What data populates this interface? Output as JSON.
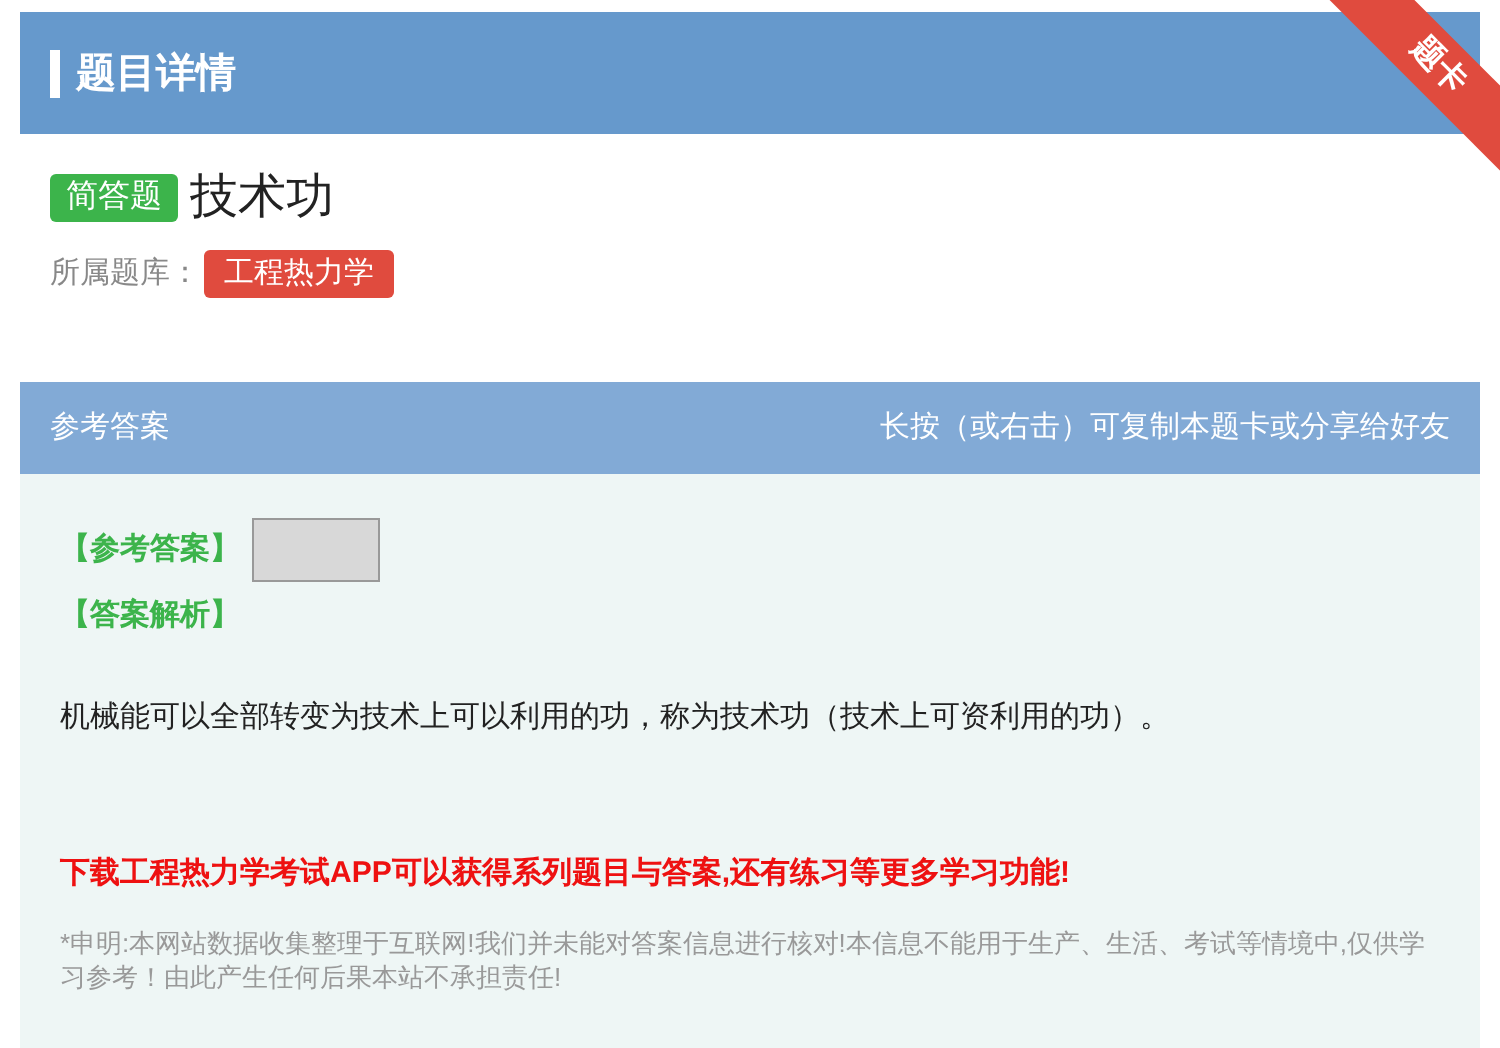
{
  "header": {
    "title": "题目详情",
    "ribbon": "题卡"
  },
  "question": {
    "type_badge": "简答题",
    "title": "技术功",
    "bank_label": "所属题库：",
    "bank": "工程热力学"
  },
  "answer_panel": {
    "title": "参考答案",
    "hint": "长按（或右击）可复制本题卡或分享给好友",
    "answer_label": "【参考答案】",
    "analysis_label": "【答案解析】",
    "analysis": "机械能可以全部转变为技术上可以利用的功，称为技术功（技术上可资利用的功）。",
    "promo": "下载工程热力学考试APP可以获得系列题目与答案,还有练习等更多学习功能!",
    "disclaimer": "*申明:本网站数据收集整理于互联网!我们并未能对答案信息进行核对!本信息不能用于生产、生活、考试等情境中,仅供学习参考！由此产生任何后果本站不承担责任!"
  }
}
